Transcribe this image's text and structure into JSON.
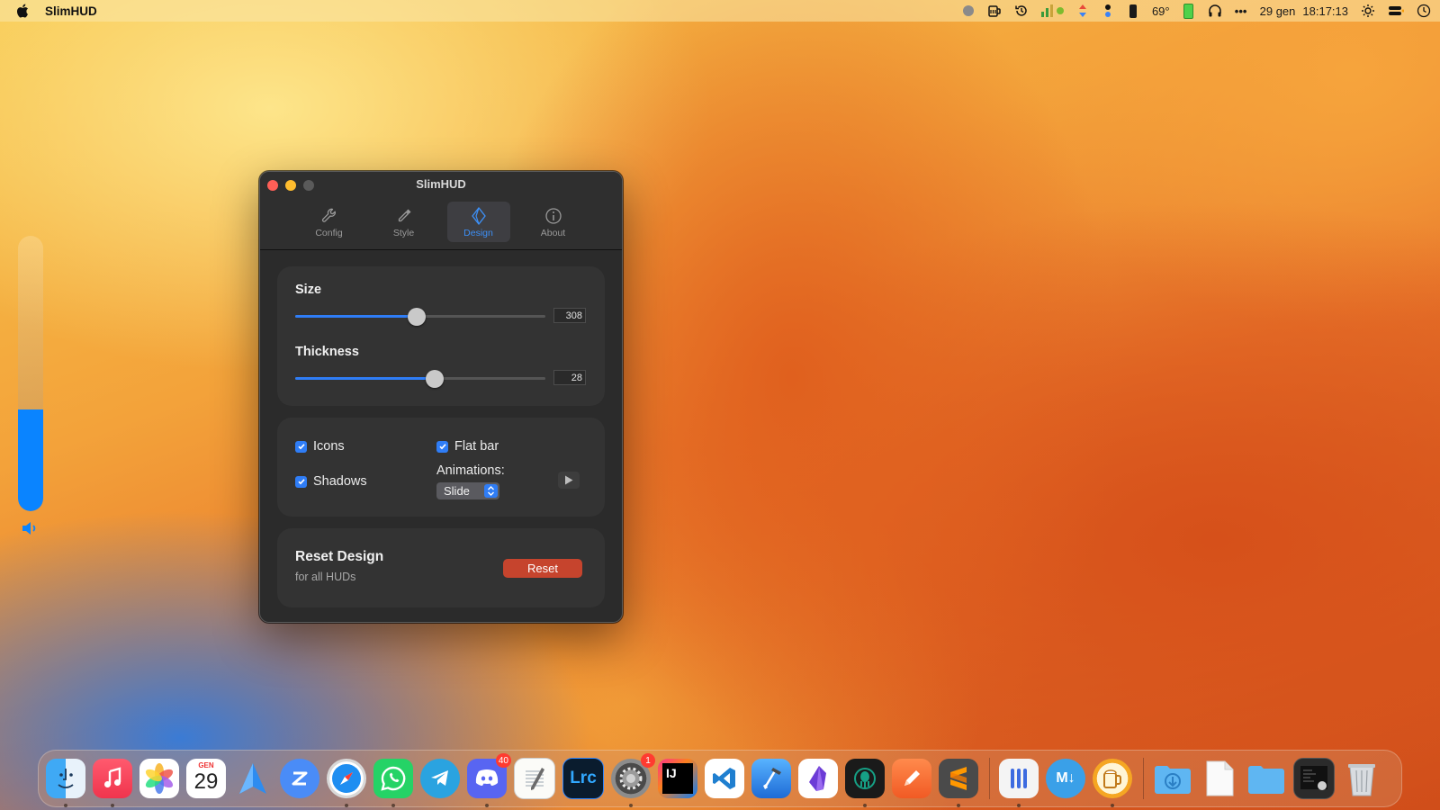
{
  "menubar": {
    "app_name": "SlimHUD",
    "temperature": "69°",
    "date": "29 gen",
    "time": "18:17:13",
    "more": "•••"
  },
  "hud": {
    "level_fraction": 0.37,
    "accent": "#0a84ff"
  },
  "window": {
    "title": "SlimHUD",
    "tabs": [
      {
        "label": "Config",
        "icon": "wrench-icon"
      },
      {
        "label": "Style",
        "icon": "eyedropper-icon"
      },
      {
        "label": "Design",
        "icon": "design-icon"
      },
      {
        "label": "About",
        "icon": "info-icon"
      }
    ],
    "active_tab": "Design",
    "size": {
      "label": "Size",
      "value": "308",
      "fraction": 0.485
    },
    "thickness": {
      "label": "Thickness",
      "value": "28",
      "fraction": 0.556
    },
    "options": {
      "icons_label": "Icons",
      "icons_checked": true,
      "shadows_label": "Shadows",
      "shadows_checked": true,
      "flat_bar_label": "Flat bar",
      "flat_bar_checked": true,
      "animations_label": "Animations:",
      "animation_value": "Slide"
    },
    "reset": {
      "title": "Reset Design",
      "subtitle": "for all HUDs",
      "button": "Reset"
    },
    "accent": "#2f7df6",
    "reset_color": "#c6442d"
  },
  "dock": {
    "calendar_month": "GEN",
    "calendar_day": "29",
    "discord_badge": "40",
    "settings_badge": "1",
    "intellij_label": "IJ",
    "lightroom_label": "Lrc",
    "markdown_label": "M↓"
  }
}
